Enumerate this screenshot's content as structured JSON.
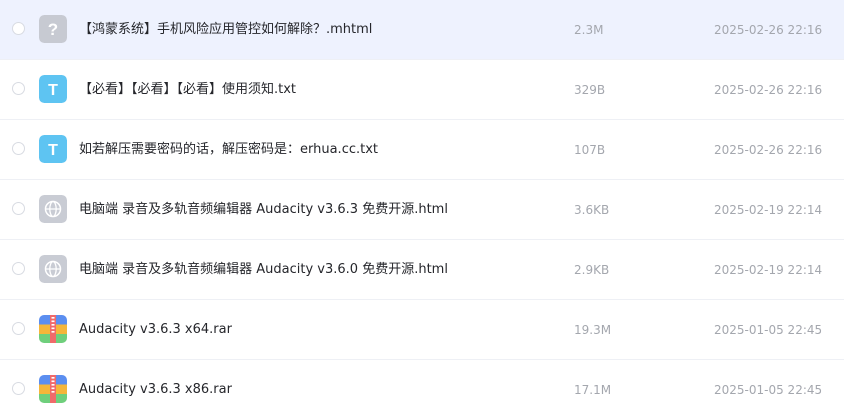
{
  "files": [
    {
      "name": "【鸿蒙系统】手机风险应用管控如何解除？.mhtml",
      "size": "2.3M",
      "date": "2025-02-26 22:16",
      "icon": "unknown-file-icon",
      "selected": true
    },
    {
      "name": "【必看】【必看】【必看】使用须知.txt",
      "size": "329B",
      "date": "2025-02-26 22:16",
      "icon": "text-file-icon",
      "selected": false
    },
    {
      "name": "如若解压需要密码的话，解压密码是：erhua.cc.txt",
      "size": "107B",
      "date": "2025-02-26 22:16",
      "icon": "text-file-icon",
      "selected": false
    },
    {
      "name": "电脑端 录音及多轨音频编辑器 Audacity v3.6.3 免费开源.html",
      "size": "3.6KB",
      "date": "2025-02-19 22:14",
      "icon": "web-file-icon",
      "selected": false
    },
    {
      "name": "电脑端 录音及多轨音频编辑器 Audacity v3.6.0 免费开源.html",
      "size": "2.9KB",
      "date": "2025-02-19 22:14",
      "icon": "web-file-icon",
      "selected": false
    },
    {
      "name": "Audacity v3.6.3 x64.rar",
      "size": "19.3M",
      "date": "2025-01-05 22:45",
      "icon": "archive-file-icon",
      "selected": false
    },
    {
      "name": "Audacity v3.6.3 x86.rar",
      "size": "17.1M",
      "date": "2025-01-05 22:45",
      "icon": "archive-file-icon",
      "selected": false
    }
  ],
  "icon_glyphs": {
    "unknown": "?",
    "text": "T"
  },
  "colors": {
    "selected_row": "#eef2fe",
    "text_icon": "#5ec4f2",
    "unknown_icon": "#c7cad2",
    "web_icon": "#c9ccd4"
  }
}
